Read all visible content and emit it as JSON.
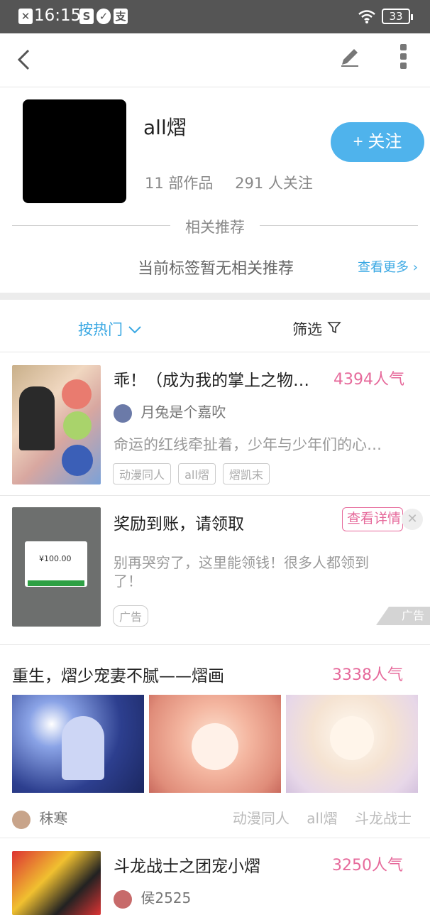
{
  "status_bar": {
    "time": "16:15",
    "battery": "33",
    "icons": [
      "close-box-icon",
      "s-icon",
      "check-circle-icon",
      "pay-icon",
      "wifi-icon"
    ]
  },
  "top_bar": {
    "icons": [
      "back-chevron-icon",
      "pencil-icon",
      "vertical-dots-icon"
    ]
  },
  "profile": {
    "name": "all熠",
    "works": "11 部作品",
    "followers": "291 人关注",
    "follow_label": "+ 关注",
    "related_title": "相关推荐",
    "no_related": "当前标签暂无相关推荐",
    "see_more": "查看更多"
  },
  "filters": {
    "sort_label": "按热门",
    "filter_label": "筛选"
  },
  "items": [
    {
      "title": "乖！（成为我的掌上之物…",
      "popularity": "4394人气",
      "author": "月兔是个嘉吹",
      "desc": "命运的红线牵扯着，少年与少年们的心…",
      "tags": [
        "动漫同人",
        "all熠",
        "熠凯末"
      ]
    },
    {
      "title": "奖励到账，请领取",
      "detail_label": "查看详情",
      "desc1": "别再哭穷了，这里能领钱！很多人都领到",
      "desc2": "了！",
      "ad_tag": "广告",
      "ad_corner": "广告",
      "thumb_amount": "¥100.00"
    },
    {
      "title": "重生，熠少宠妻不腻——熠画",
      "popularity": "3338人气",
      "author": "秣寒",
      "tags": [
        "动漫同人",
        "all熠",
        "斗龙战士"
      ]
    },
    {
      "title": "斗龙战士之团宠小熠",
      "popularity": "3250人气",
      "author": "侯2525"
    }
  ],
  "colors": {
    "accent_blue": "#4fb3ec",
    "pink": "#e66a9b",
    "status_bar": "#555555"
  }
}
